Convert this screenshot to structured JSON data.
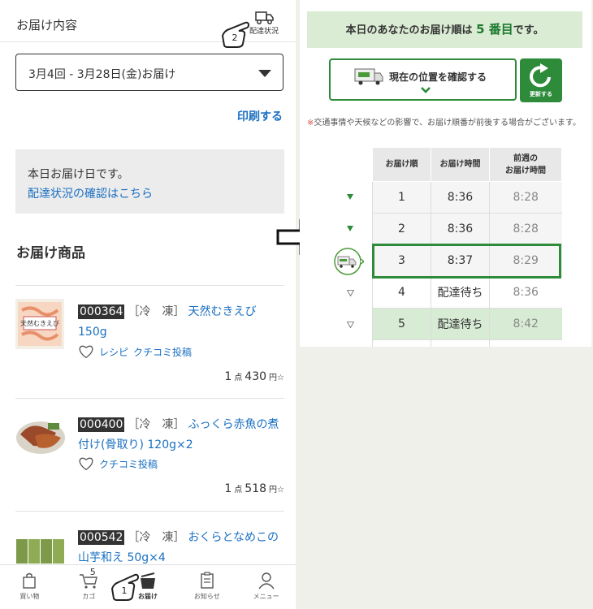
{
  "left": {
    "header_title": "お届け内容",
    "truck_label": "配達状況",
    "dropdown_value": "3月4回 - 3月28日(金)お届け",
    "print_link": "印刷する",
    "notice_text": "本日お届け日です。",
    "notice_link": "配達状況の確認はこちら",
    "section_title": "お届け商品",
    "products": [
      {
        "code": "000364",
        "frozen": "［冷　凍］",
        "name": "天然むきえび150g",
        "actions": [
          "レシピ",
          "クチコミ投稿"
        ],
        "qty": "1",
        "qty_unit": "点",
        "price": "430",
        "yen": "円☆",
        "image_label": "天然むきえび"
      },
      {
        "code": "000400",
        "frozen": "［冷　凍］",
        "name": "ふっくら赤魚の煮付け(骨取り) 120g×2",
        "actions": [
          "クチコミ投稿"
        ],
        "qty": "1",
        "qty_unit": "点",
        "price": "518",
        "yen": "円☆"
      },
      {
        "code": "000542",
        "frozen": "［冷　凍］",
        "name": "おくらとなめこの山芋和え 50g×4"
      }
    ],
    "nav": [
      {
        "label": "買い物",
        "icon": "shopping-bag-icon"
      },
      {
        "label": "カゴ",
        "icon": "cart-icon",
        "count": "5"
      },
      {
        "label": "お届け",
        "icon": "delivery-box-icon"
      },
      {
        "label": "お知らせ",
        "icon": "notice-icon"
      },
      {
        "label": "メニュー",
        "icon": "user-icon"
      }
    ],
    "hand_labels": [
      "1",
      "2"
    ]
  },
  "right": {
    "rank_prefix": "本日のあなたのお届け順は ",
    "rank_num": "5 番目",
    "rank_suffix": "です。",
    "location_button": "現在の位置を確認する",
    "refresh_label": "更新する",
    "note_mark": "※",
    "note_text": "交通事情や天候などの影響で、お届け順番が前後する場合がございます。",
    "table": {
      "headers": [
        "お届け順",
        "お届け時間",
        "前週の\nお届け時間"
      ],
      "rows": [
        {
          "order": "1",
          "time": "8:36",
          "prev": "8:28",
          "state": "done"
        },
        {
          "order": "2",
          "time": "8:36",
          "prev": "8:28",
          "state": "done"
        },
        {
          "order": "3",
          "time": "8:37",
          "prev": "8:29",
          "state": "current"
        },
        {
          "order": "4",
          "time": "配達待ち",
          "prev": "8:36",
          "state": "waiting"
        },
        {
          "order": "5",
          "time": "配達待ち",
          "prev": "8:42",
          "state": "mine"
        }
      ]
    }
  },
  "colors": {
    "accent_green": "#2e8b3a",
    "link_blue": "#1a6fc2",
    "banner_green": "#dbecd5"
  }
}
